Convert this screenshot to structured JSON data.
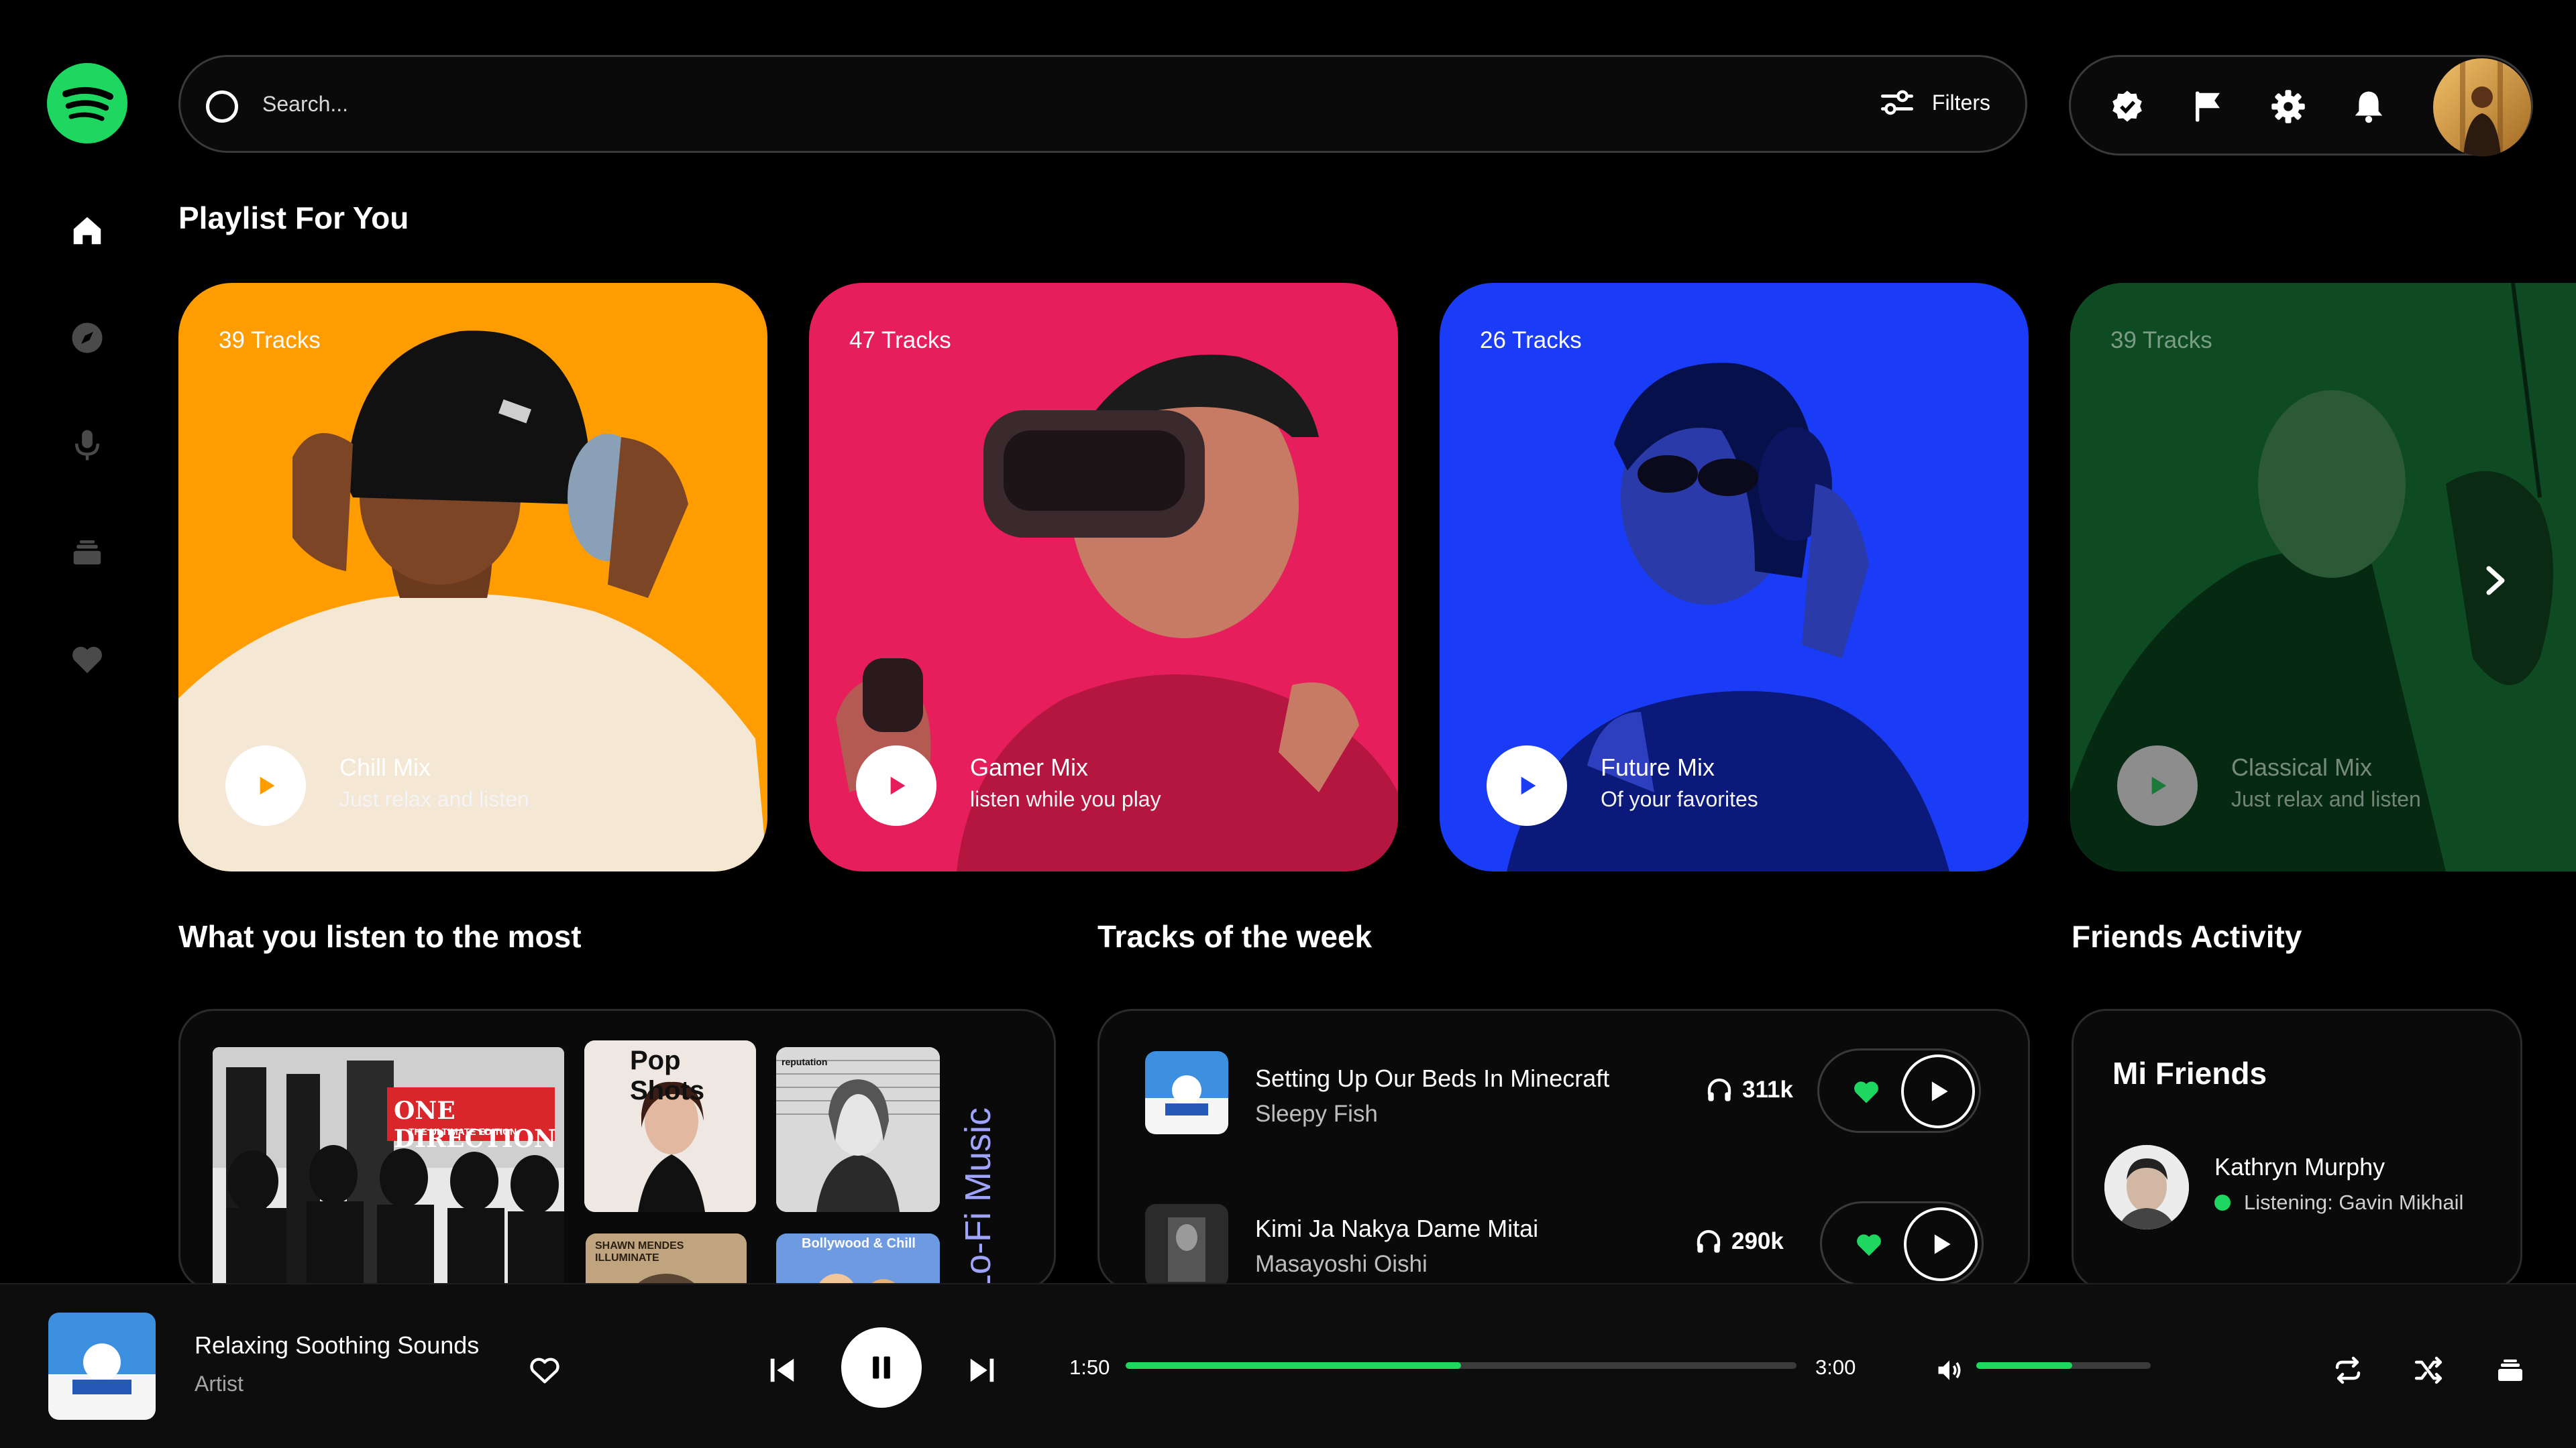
{
  "header": {
    "search_placeholder": "Search...",
    "filters_label": "Filters",
    "icons": [
      "check-badge-icon",
      "flag-icon",
      "gear-icon",
      "bell-icon"
    ]
  },
  "sidebar": {
    "items": [
      "home-icon",
      "compass-icon",
      "microphone-icon",
      "library-icon",
      "heart-icon"
    ]
  },
  "playlists": {
    "title": "Playlist For You",
    "cards": [
      {
        "tracks": "39 Tracks",
        "title": "Chill Mix",
        "subtitle": "Just relax and listen",
        "color": "#ff9d00"
      },
      {
        "tracks": "47 Tracks",
        "title": "Gamer Mix",
        "subtitle": "listen while you play",
        "color": "#e61f5c"
      },
      {
        "tracks": "26 Tracks",
        "title": "Future Mix",
        "subtitle": "Of your favorites",
        "color": "#1b3cf7"
      },
      {
        "tracks": "39 Tracks",
        "title": "Classical Mix",
        "subtitle": "Just relax and listen",
        "color": "#1b7a3a"
      }
    ]
  },
  "most_listened": {
    "title": "What you listen to the most",
    "albums": [
      {
        "text": "ONE DIRECTION",
        "subtext": "THE ULTIMATE EDITION"
      },
      {
        "text": "Pop Shots"
      },
      {
        "text": "reputation"
      },
      {
        "text": "SHAWN MENDES ILLUMINATE"
      },
      {
        "text": "Bollywood & Chill"
      }
    ],
    "side_label": "Lo-Fi Music"
  },
  "tracks_week": {
    "title": "Tracks of the week",
    "tracks": [
      {
        "title": "Setting Up Our Beds In Minecraft",
        "artist": "Sleepy Fish",
        "plays": "311k"
      },
      {
        "title": "Kimi Ja Nakya Dame Mitai",
        "artist": "Masayoshi Oishi",
        "plays": "290k"
      }
    ]
  },
  "friends": {
    "section_title": "Friends Activity",
    "panel_title": "Mi Friends",
    "list": [
      {
        "name": "Kathryn Murphy",
        "status": "Listening: Gavin Mikhail"
      }
    ]
  },
  "player": {
    "title": "Relaxing Soothing Sounds",
    "artist": "Artist",
    "current_time": "1:50",
    "total_time": "3:00",
    "progress": 0.5,
    "volume": 0.55,
    "accent": "#1ed760"
  }
}
